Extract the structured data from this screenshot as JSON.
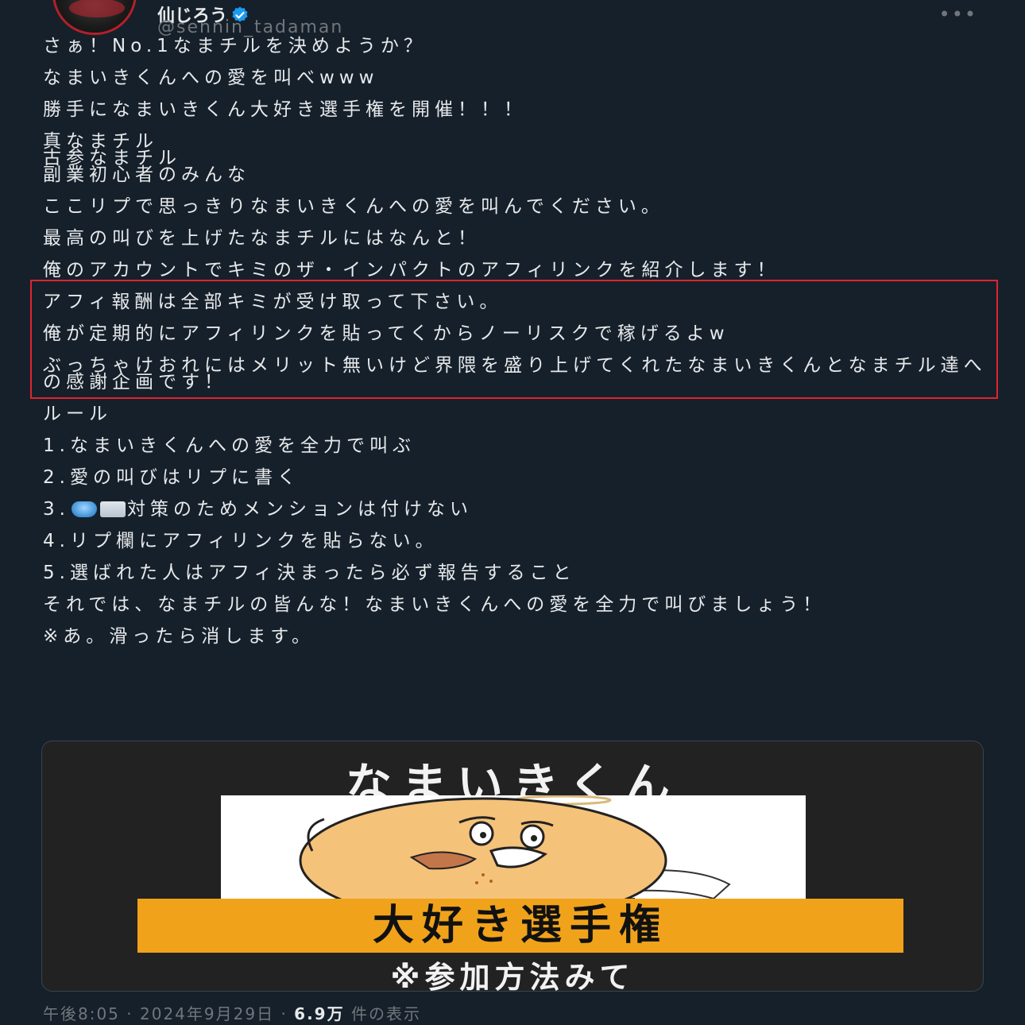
{
  "header": {
    "display_name": "仙じろう",
    "handle": "@sennin_tadaman",
    "more_icon": "more-horizontal-icon",
    "verified_color": "#1d9bf0"
  },
  "tweet": {
    "paragraphs": [
      "さぁ！No.1なまチルを決めようか？",
      "なまいきくんへの愛を叫べwww",
      "勝手になまいきくん大好き選手権を開催！！！",
      "真なまチル\n古参なまチル\n副業初心者のみんな",
      "ここリプで思っきりなまいきくんへの愛を叫んでください。",
      "最高の叫びを上げたなまチルにはなんと！",
      "俺のアカウントでキミのザ・インパクトのアフィリンクを紹介します！",
      "アフィ報酬は全部キミが受け取って下さい。",
      "俺が定期的にアフィリンクを貼ってくからノーリスクで稼げるよw",
      "ぶっちゃけおれにはメリット無いけど界隈を盛り上げてくれたなまいきくんとなまチル達への感謝企画です！",
      "ルール",
      "1.なまいきくんへの愛を全力で叫ぶ",
      "2.愛の叫びはリプに書く",
      "3.",
      "4.リプ欄にアフィリンクを貼らない。",
      "5.選ばれた人はアフィ決まったら必ず報告すること",
      "それでは、なまチルの皆んな！なまいきくんへの愛を全力で叫びましょう！",
      "※あ。滑ったら消します。"
    ],
    "rule3_suffix": "対策のためメンションは付けない",
    "highlight_color": "#e0242e"
  },
  "media": {
    "title": "なまいきくん",
    "band_text": "大好き選手権",
    "subtitle": "※参加方法みて",
    "band_color": "#f0a31a"
  },
  "meta": {
    "time": "午後8:05",
    "date": "2024年9月29日",
    "views_count": "6.9万",
    "views_label": "件の表示"
  }
}
